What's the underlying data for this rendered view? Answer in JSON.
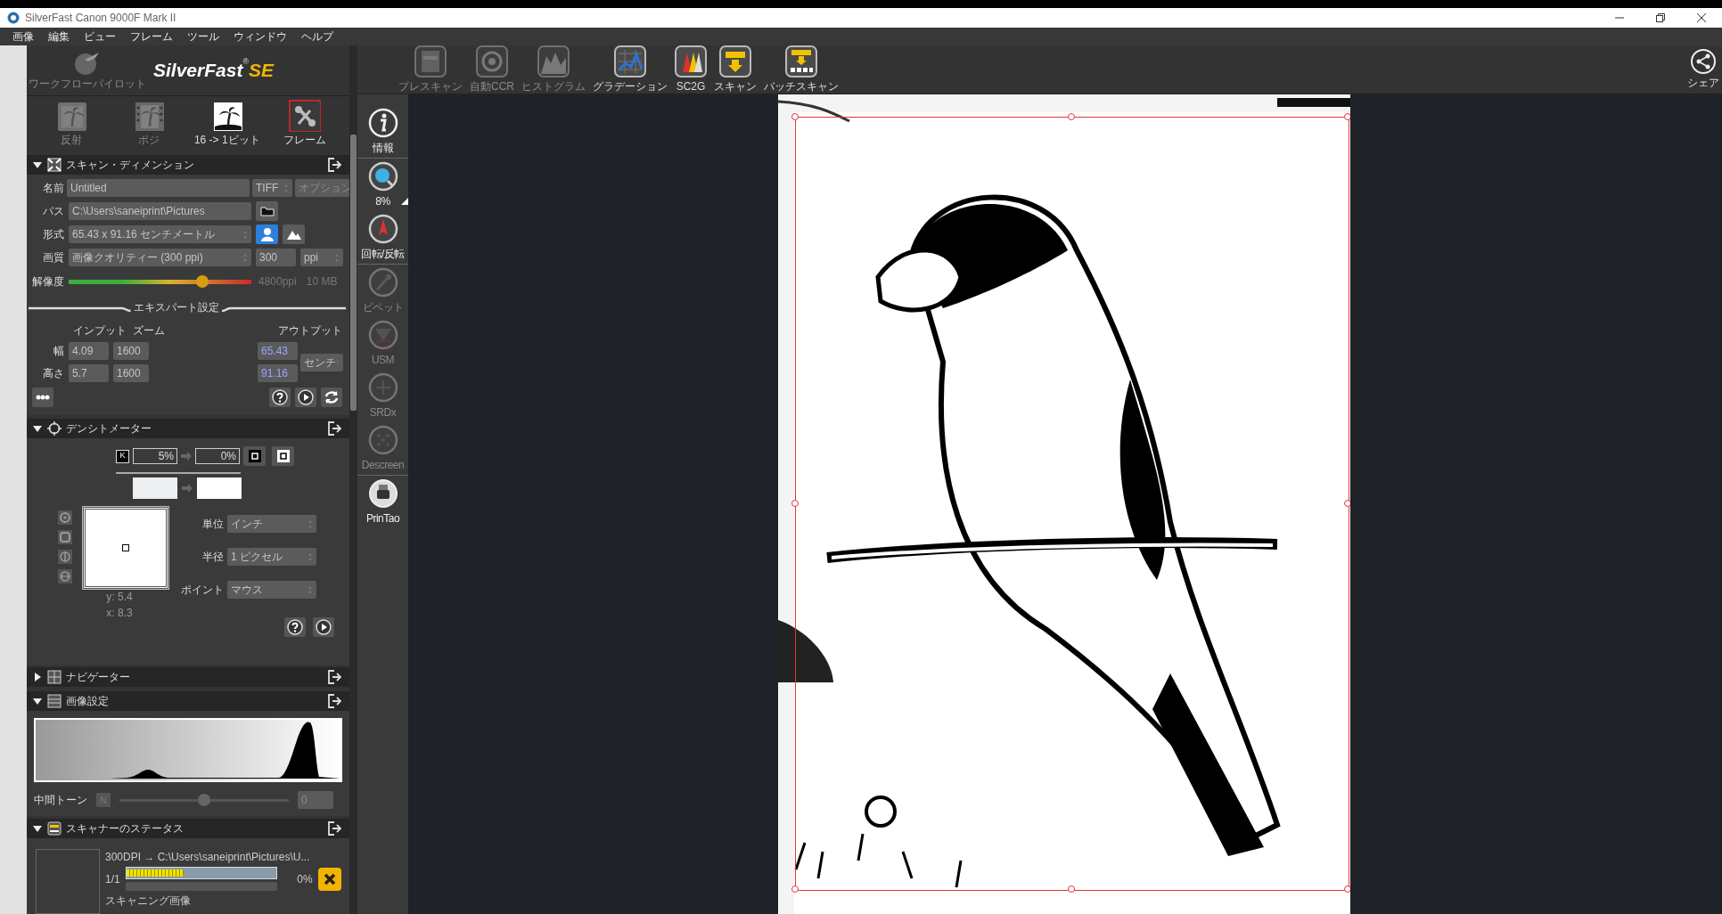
{
  "window": {
    "title": "SilverFast  Canon 9000F Mark II"
  },
  "menu": [
    "画像",
    "編集",
    "ビュー",
    "フレーム",
    "ツール",
    "ウィンドウ",
    "ヘルプ"
  ],
  "header": {
    "pilot_label": "ワークフローパイロット",
    "logo": "SilverFast",
    "logo_mark": "®",
    "logo_suffix": "SE"
  },
  "modes": [
    {
      "kind": "reflective",
      "label": "反射",
      "disabled": true,
      "selected": false
    },
    {
      "kind": "positive",
      "label": "ポジ",
      "disabled": true,
      "selected": false
    },
    {
      "kind": "bitdepth",
      "label": "16 -> 1ビット",
      "disabled": false,
      "selected": false
    },
    {
      "kind": "frame",
      "label": "フレーム",
      "disabled": false,
      "selected": true
    }
  ],
  "scan_dimension": {
    "title": "スキャン・ディメンション",
    "expanded": true,
    "name": {
      "label": "名前",
      "value": "Untitled",
      "format": "TIFF",
      "options": "オプション"
    },
    "path": {
      "label": "パス",
      "value": "C:\\Users\\saneiprint\\Pictures"
    },
    "size": {
      "label": "形式",
      "value": "65.43 x 91.16 センチメートル",
      "orientations": [
        {
          "kind": "portrait",
          "selected": true
        },
        {
          "kind": "landscape",
          "selected": false
        }
      ]
    },
    "quality": {
      "label": "画質",
      "value": "画像クオリティー (300 ppi)",
      "ppi": "300",
      "unit": "ppi"
    },
    "resolution": {
      "label": "解像度",
      "level": 0.73,
      "max": "4800ppi",
      "size": "10 MB"
    },
    "expert_title": "エキスパート設定",
    "columns": [
      "インプット",
      "ズーム",
      "アウトプット"
    ],
    "dims": [
      {
        "label": "幅",
        "input": "4.09",
        "zoom": "1600",
        "output": "65.43"
      },
      {
        "label": "高さ",
        "input": "5.7",
        "zoom": "1600",
        "output": "91.16"
      }
    ],
    "output_unit": "センチ"
  },
  "densitometer": {
    "title": "デンシトメーター",
    "expanded": true,
    "channel": "K",
    "from": "5%",
    "to": "0%",
    "coords": [
      "y: 5.4",
      "x: 8.3"
    ],
    "settings": [
      {
        "label": "単位",
        "value": "インチ"
      },
      {
        "label": "半径",
        "value": "1 ピクセル"
      },
      {
        "label": "ポイント",
        "value": "マウス"
      }
    ]
  },
  "navigator": {
    "title": "ナビゲーター",
    "expanded": false
  },
  "image_settings": {
    "title": "画像設定",
    "expanded": true,
    "midtone": {
      "label": "中間トーン",
      "channel": "N",
      "level": 0.5,
      "value": "0"
    }
  },
  "scanner_status": {
    "title": "スキャナーのステータス",
    "expanded": true,
    "job": "300DPI → C:\\Users\\saneiprint\\Pictures\\U...",
    "count": "1/1",
    "percent": "0%",
    "level": 0.38,
    "label": "スキャニング画像"
  },
  "toolbar": [
    {
      "kind": "prescan",
      "label": "プレスキャン",
      "disabled": true
    },
    {
      "kind": "ccr",
      "label": "自動CCR",
      "disabled": true
    },
    {
      "kind": "histogram",
      "label": "ヒストグラム",
      "disabled": true
    },
    {
      "kind": "gradation",
      "label": "グラデーション",
      "disabled": false
    },
    {
      "kind": "sc2g",
      "label": "SC2G",
      "disabled": false
    },
    {
      "kind": "scan",
      "label": "スキャン",
      "disabled": false
    },
    {
      "kind": "batch",
      "label": "バッチスキャン",
      "disabled": false
    }
  ],
  "share": {
    "label": "シェア"
  },
  "side_tools": [
    [
      {
        "kind": "info",
        "label": "情報",
        "disabled": false
      }
    ],
    [
      {
        "kind": "zoom",
        "label": "8%",
        "disabled": false
      },
      {
        "kind": "rotate",
        "label": "回転/反転",
        "disabled": false
      }
    ],
    [
      {
        "kind": "pipette",
        "label": "ピペット",
        "disabled": true
      },
      {
        "kind": "usm",
        "label": "USM",
        "disabled": true
      },
      {
        "kind": "srdx",
        "label": "SRDx",
        "disabled": true
      },
      {
        "kind": "descreen",
        "label": "Descreen",
        "disabled": true
      }
    ],
    [
      {
        "kind": "printao",
        "label": "PrinTao",
        "disabled": false
      }
    ]
  ]
}
